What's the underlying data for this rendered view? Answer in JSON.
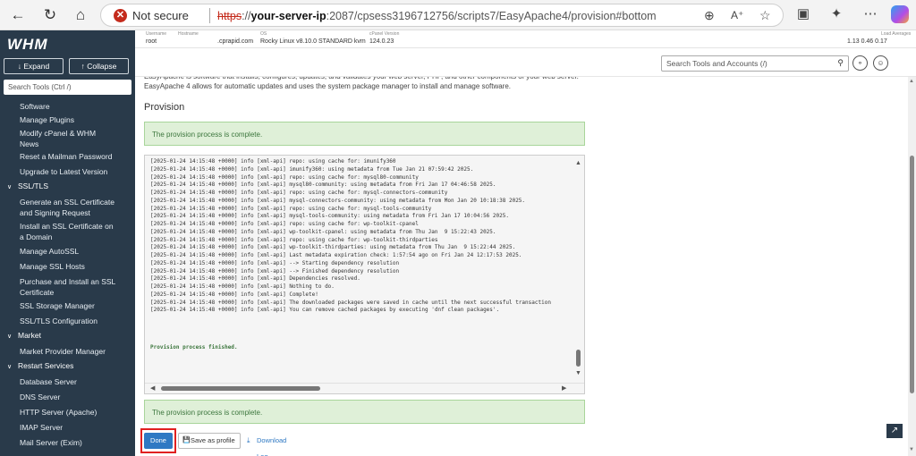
{
  "browser": {
    "not_secure": "Not secure",
    "url_proto": "https",
    "url_sep": "://",
    "url_host": "your-server-ip",
    "url_rest": ":2087/cpsess3196712756/scripts7/EasyApache4/provision#bottom"
  },
  "sidebar": {
    "logo": "WHM",
    "expand": "↓ Expand",
    "collapse": "↑ Collapse",
    "search_placeholder": "Search Tools (Ctrl /)",
    "items": [
      {
        "label": "Software"
      },
      {
        "label": "Manage Plugins"
      },
      {
        "label": "Modify cPanel & WHM News"
      },
      {
        "label": "Reset a Mailman Password"
      },
      {
        "label": "Upgrade to Latest Version"
      },
      {
        "label": "SSL/TLS"
      },
      {
        "label": "Generate an SSL Certificate and Signing Request"
      },
      {
        "label": "Install an SSL Certificate on a Domain"
      },
      {
        "label": "Manage AutoSSL"
      },
      {
        "label": "Manage SSL Hosts"
      },
      {
        "label": "Purchase and Install an SSL Certificate"
      },
      {
        "label": "SSL Storage Manager"
      },
      {
        "label": "SSL/TLS Configuration"
      },
      {
        "label": "Market"
      },
      {
        "label": "Market Provider Manager"
      },
      {
        "label": "Restart Services"
      },
      {
        "label": "Database Server"
      },
      {
        "label": "DNS Server"
      },
      {
        "label": "HTTP Server (Apache)"
      },
      {
        "label": "IMAP Server"
      },
      {
        "label": "Mail Server (Exim)"
      }
    ]
  },
  "topinfo": {
    "username_label": "Username",
    "username": "root",
    "hostname_label": "Hostname",
    "hostname": ".cprapid.com",
    "os_label": "OS",
    "os": "Rocky Linux v8.10.0 STANDARD kvm",
    "cpanel_label": "cPanel Version",
    "cpanel": "124.0.23",
    "load_label": "Load Averages",
    "load": "1.13  0.46  0.17"
  },
  "search": {
    "placeholder": "Search Tools and Accounts (/)"
  },
  "main": {
    "desc_line1": "EasyApache is software that installs, configures, updates, and validates your web server, PHP, and other components of your web server.",
    "desc_line2": "EasyApache 4 allows for automatic updates and uses the system package manager to install and manage software.",
    "heading": "Provision",
    "alert_top": "The provision process is complete.",
    "alert_bottom": "The provision process is complete.",
    "log_lines": [
      "[2025-01-24 14:15:48 +0000] info [xml-api] repo: using cache for: imunify360",
      "[2025-01-24 14:15:48 +0000] info [xml-api] imunify360: using metadata from Tue Jan 21 07:59:42 2025.",
      "[2025-01-24 14:15:48 +0000] info [xml-api] repo: using cache for: mysql80-community",
      "[2025-01-24 14:15:48 +0000] info [xml-api] mysql80-community: using metadata from Fri Jan 17 04:46:58 2025.",
      "[2025-01-24 14:15:48 +0000] info [xml-api] repo: using cache for: mysql-connectors-community",
      "[2025-01-24 14:15:48 +0000] info [xml-api] mysql-connectors-community: using metadata from Mon Jan 20 10:18:38 2025.",
      "[2025-01-24 14:15:48 +0000] info [xml-api] repo: using cache for: mysql-tools-community",
      "[2025-01-24 14:15:48 +0000] info [xml-api] mysql-tools-community: using metadata from Fri Jan 17 10:04:56 2025.",
      "[2025-01-24 14:15:48 +0000] info [xml-api] repo: using cache for: wp-toolkit-cpanel",
      "[2025-01-24 14:15:48 +0000] info [xml-api] wp-toolkit-cpanel: using metadata from Thu Jan  9 15:22:43 2025.",
      "[2025-01-24 14:15:48 +0000] info [xml-api] repo: using cache for: wp-toolkit-thirdparties",
      "[2025-01-24 14:15:48 +0000] info [xml-api] wp-toolkit-thirdparties: using metadata from Thu Jan  9 15:22:44 2025.",
      "[2025-01-24 14:15:48 +0000] info [xml-api] Last metadata expiration check: 1:57:54 ago on Fri Jan 24 12:17:53 2025.",
      "[2025-01-24 14:15:48 +0000] info [xml-api] --> Starting dependency resolution",
      "[2025-01-24 14:15:48 +0000] info [xml-api] --> Finished dependency resolution",
      "[2025-01-24 14:15:48 +0000] info [xml-api] Dependencies resolved.",
      "[2025-01-24 14:15:48 +0000] info [xml-api] Nothing to do.",
      "[2025-01-24 14:15:48 +0000] info [xml-api] Complete!",
      "[2025-01-24 14:15:48 +0000] info [xml-api] The downloaded packages were saved in cache until the next successful transaction",
      "[2025-01-24 14:15:48 +0000] info [xml-api] You can remove cached packages by executing 'dnf clean packages'."
    ],
    "log_finished": "Provision process finished.",
    "done_label": "Done",
    "save_label": "Save as profile",
    "download_label": "Download Log"
  }
}
